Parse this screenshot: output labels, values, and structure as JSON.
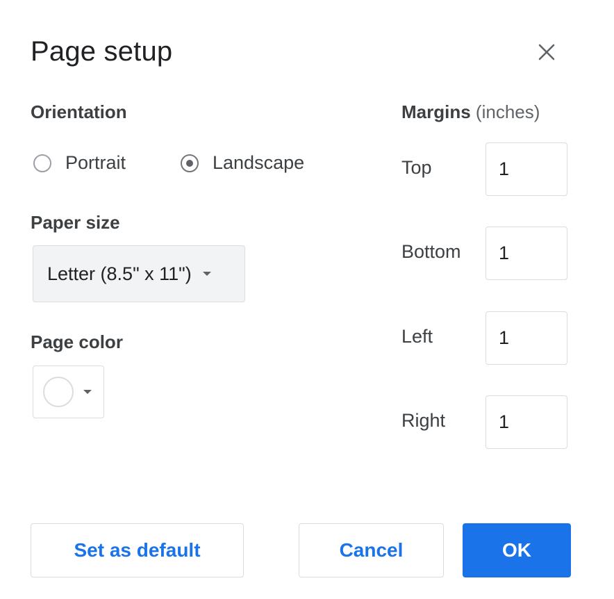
{
  "dialog": {
    "title": "Page setup"
  },
  "icons": {
    "close": "close-icon",
    "dropdown": "chevron-down-icon"
  },
  "orientation": {
    "label": "Orientation",
    "options": [
      {
        "label": "Portrait",
        "selected": false
      },
      {
        "label": "Landscape",
        "selected": true
      }
    ]
  },
  "paper_size": {
    "label": "Paper size",
    "value": "Letter (8.5\" x 11\")"
  },
  "page_color": {
    "label": "Page color",
    "value": "#ffffff"
  },
  "margins": {
    "title": "Margins",
    "unit": "(inches)",
    "top": {
      "label": "Top",
      "value": "1"
    },
    "bottom": {
      "label": "Bottom",
      "value": "1"
    },
    "left": {
      "label": "Left",
      "value": "1"
    },
    "right": {
      "label": "Right",
      "value": "1"
    }
  },
  "buttons": {
    "set_default": "Set as default",
    "cancel": "Cancel",
    "ok": "OK"
  },
  "colors": {
    "accent": "#1a73e8",
    "border": "#dadce0",
    "select_bg": "#f1f3f4"
  }
}
